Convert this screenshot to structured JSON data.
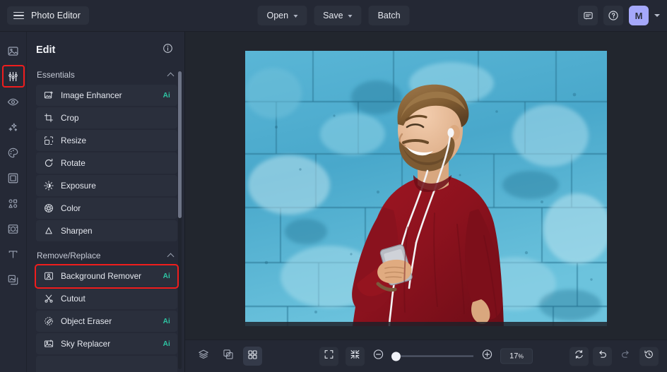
{
  "app": {
    "title": "Photo Editor",
    "menu_icon": "hamburger-icon"
  },
  "topbar": {
    "open_label": "Open",
    "save_label": "Save",
    "batch_label": "Batch",
    "feedback_icon": "chat-bubble-icon",
    "help_icon": "question-circle-icon",
    "avatar_initial": "M",
    "avatar_color": "#a5a8fa",
    "account_caret": "chevron-down-icon"
  },
  "rail": {
    "items": [
      {
        "name": "image-tool",
        "icon": "image-icon",
        "selected": false
      },
      {
        "name": "adjust-tool",
        "icon": "sliders-icon",
        "selected": true
      },
      {
        "name": "retouch-tool",
        "icon": "eye-icon",
        "selected": false
      },
      {
        "name": "effects-tool",
        "icon": "sparkles-icon",
        "selected": false
      },
      {
        "name": "color-tool",
        "icon": "palette-icon",
        "selected": false
      },
      {
        "name": "frame-tool",
        "icon": "frame-icon",
        "selected": false
      },
      {
        "name": "shapes-tool",
        "icon": "shapes-icon",
        "selected": false
      },
      {
        "name": "focus-tool",
        "icon": "focus-frame-icon",
        "selected": false
      },
      {
        "name": "text-tool",
        "icon": "text-t-icon",
        "selected": false
      },
      {
        "name": "layers-tool",
        "icon": "layers-copy-icon",
        "selected": false
      }
    ]
  },
  "panel": {
    "title": "Edit",
    "info_icon": "info-circle-icon",
    "groups": [
      {
        "name": "essentials",
        "title": "Essentials",
        "collapse_icon": "chevron-up-icon",
        "tools": [
          {
            "label": "Image Enhancer",
            "icon": "image-enhance-icon",
            "ai": "Ai",
            "marked": false
          },
          {
            "label": "Crop",
            "icon": "crop-icon",
            "ai": "",
            "marked": false
          },
          {
            "label": "Resize",
            "icon": "resize-icon",
            "ai": "",
            "marked": false
          },
          {
            "label": "Rotate",
            "icon": "rotate-icon",
            "ai": "",
            "marked": false
          },
          {
            "label": "Exposure",
            "icon": "exposure-sun-icon",
            "ai": "",
            "marked": false
          },
          {
            "label": "Color",
            "icon": "color-wheel-icon",
            "ai": "",
            "marked": false
          },
          {
            "label": "Sharpen",
            "icon": "sharpen-icon",
            "ai": "",
            "marked": false
          }
        ]
      },
      {
        "name": "remove-replace",
        "title": "Remove/Replace",
        "collapse_icon": "chevron-up-icon",
        "tools": [
          {
            "label": "Background Remover",
            "icon": "background-remover-icon",
            "ai": "Ai",
            "marked": true
          },
          {
            "label": "Cutout",
            "icon": "scissors-icon",
            "ai": "",
            "marked": false
          },
          {
            "label": "Object Eraser",
            "icon": "object-eraser-icon",
            "ai": "Ai",
            "marked": false
          },
          {
            "label": "Sky Replacer",
            "icon": "sky-replacer-icon",
            "ai": "Ai",
            "marked": false
          }
        ]
      }
    ],
    "highlight_color": "#f01d1d",
    "ai_badge_color": "#2ec6a4"
  },
  "canvas": {
    "image_alt": "Smiling bearded man in red sweater with white earphones holding a phone, standing in front of a blue painted cinder block wall"
  },
  "bottombar": {
    "left_tools": [
      {
        "name": "layers-button",
        "icon": "layers-stack-icon",
        "active": false
      },
      {
        "name": "compare-button",
        "icon": "compare-split-icon",
        "active": false
      },
      {
        "name": "grid-button",
        "icon": "grid-four-icon",
        "active": true
      }
    ],
    "center_tools": [
      {
        "name": "fit-screen-button",
        "icon": "expand-brackets-icon"
      },
      {
        "name": "actual-size-button",
        "icon": "collapse-arrows-icon"
      }
    ],
    "zoom_out_icon": "minus-circle-icon",
    "zoom_in_icon": "plus-circle-icon",
    "zoom_value": "17",
    "zoom_unit": "%",
    "zoom_slider_position": 0,
    "right_tools": [
      {
        "name": "reset-button",
        "icon": "reset-sync-icon",
        "enabled": true
      },
      {
        "name": "undo-button",
        "icon": "undo-arrow-icon",
        "enabled": true
      },
      {
        "name": "redo-button",
        "icon": "redo-arrow-icon",
        "enabled": false
      },
      {
        "name": "history-button",
        "icon": "history-clock-icon",
        "enabled": true
      }
    ]
  }
}
